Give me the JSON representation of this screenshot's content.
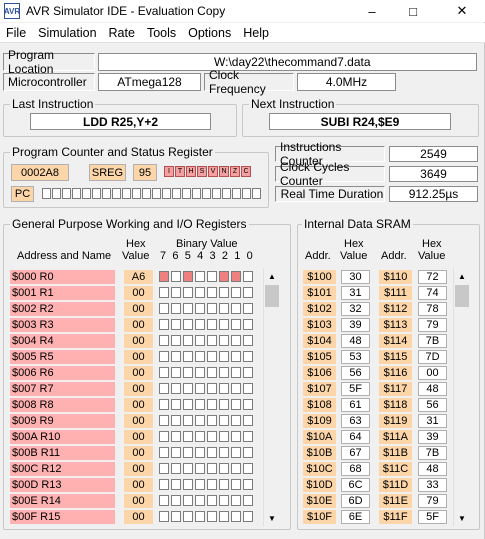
{
  "window": {
    "icon_text": "AVR",
    "title": "AVR Simulator IDE - Evaluation Copy",
    "minimize": "–",
    "maximize": "□",
    "close": "✕"
  },
  "menu": [
    "File",
    "Simulation",
    "Rate",
    "Tools",
    "Options",
    "Help"
  ],
  "top": {
    "program_location_label": "Program Location",
    "program_location": "W:\\day22\\thecommand7.data",
    "microcontroller_label": "Microcontroller",
    "microcontroller": "ATmega128",
    "clock_frequency_label": "Clock Frequency",
    "clock_frequency": "4.0MHz"
  },
  "last_instruction": {
    "title": "Last Instruction",
    "value": "LDD R25,Y+2"
  },
  "next_instruction": {
    "title": "Next Instruction",
    "value": "SUBI R24,$E9"
  },
  "pc_sreg": {
    "title": "Program Counter and Status Register",
    "pc_value": "0002A8",
    "sreg_label": "SREG",
    "sreg_value": "95",
    "flags": [
      "I",
      "T",
      "H",
      "S",
      "V",
      "N",
      "Z",
      "C"
    ],
    "pc_label": "PC"
  },
  "counters": {
    "instructions_label": "Instructions Counter",
    "instructions": "2549",
    "clock_cycles_label": "Clock Cycles Counter",
    "clock_cycles": "3649",
    "real_time_label": "Real Time Duration",
    "real_time": "912.25µs"
  },
  "registers": {
    "title": "General Purpose Working and I/O Registers",
    "col_address": "Address and Name",
    "col_hex_1": "Hex",
    "col_hex_2": "Value",
    "col_binary": "Binary Value",
    "bit_labels": "7 6 5 4 3 2 1 0",
    "rows": [
      {
        "name": "$000  R0",
        "hex": "A6",
        "bits": [
          1,
          0,
          1,
          0,
          0,
          1,
          1,
          0
        ]
      },
      {
        "name": "$001  R1",
        "hex": "00",
        "bits": [
          0,
          0,
          0,
          0,
          0,
          0,
          0,
          0
        ]
      },
      {
        "name": "$002  R2",
        "hex": "00",
        "bits": [
          0,
          0,
          0,
          0,
          0,
          0,
          0,
          0
        ]
      },
      {
        "name": "$003  R3",
        "hex": "00",
        "bits": [
          0,
          0,
          0,
          0,
          0,
          0,
          0,
          0
        ]
      },
      {
        "name": "$004  R4",
        "hex": "00",
        "bits": [
          0,
          0,
          0,
          0,
          0,
          0,
          0,
          0
        ]
      },
      {
        "name": "$005  R5",
        "hex": "00",
        "bits": [
          0,
          0,
          0,
          0,
          0,
          0,
          0,
          0
        ]
      },
      {
        "name": "$006  R6",
        "hex": "00",
        "bits": [
          0,
          0,
          0,
          0,
          0,
          0,
          0,
          0
        ]
      },
      {
        "name": "$007  R7",
        "hex": "00",
        "bits": [
          0,
          0,
          0,
          0,
          0,
          0,
          0,
          0
        ]
      },
      {
        "name": "$008  R8",
        "hex": "00",
        "bits": [
          0,
          0,
          0,
          0,
          0,
          0,
          0,
          0
        ]
      },
      {
        "name": "$009  R9",
        "hex": "00",
        "bits": [
          0,
          0,
          0,
          0,
          0,
          0,
          0,
          0
        ]
      },
      {
        "name": "$00A  R10",
        "hex": "00",
        "bits": [
          0,
          0,
          0,
          0,
          0,
          0,
          0,
          0
        ]
      },
      {
        "name": "$00B  R11",
        "hex": "00",
        "bits": [
          0,
          0,
          0,
          0,
          0,
          0,
          0,
          0
        ]
      },
      {
        "name": "$00C  R12",
        "hex": "00",
        "bits": [
          0,
          0,
          0,
          0,
          0,
          0,
          0,
          0
        ]
      },
      {
        "name": "$00D  R13",
        "hex": "00",
        "bits": [
          0,
          0,
          0,
          0,
          0,
          0,
          0,
          0
        ]
      },
      {
        "name": "$00E  R14",
        "hex": "00",
        "bits": [
          0,
          0,
          0,
          0,
          0,
          0,
          0,
          0
        ]
      },
      {
        "name": "$00F  R15",
        "hex": "00",
        "bits": [
          0,
          0,
          0,
          0,
          0,
          0,
          0,
          0
        ]
      }
    ]
  },
  "sram": {
    "title": "Internal Data SRAM",
    "col_addr": "Addr.",
    "col_hex_1": "Hex",
    "col_hex_2": "Value",
    "rows": [
      {
        "a1": "$100",
        "v1": "30",
        "a2": "$110",
        "v2": "72"
      },
      {
        "a1": "$101",
        "v1": "31",
        "a2": "$111",
        "v2": "74"
      },
      {
        "a1": "$102",
        "v1": "32",
        "a2": "$112",
        "v2": "78"
      },
      {
        "a1": "$103",
        "v1": "39",
        "a2": "$113",
        "v2": "79"
      },
      {
        "a1": "$104",
        "v1": "48",
        "a2": "$114",
        "v2": "7B"
      },
      {
        "a1": "$105",
        "v1": "53",
        "a2": "$115",
        "v2": "7D"
      },
      {
        "a1": "$106",
        "v1": "56",
        "a2": "$116",
        "v2": "00"
      },
      {
        "a1": "$107",
        "v1": "5F",
        "a2": "$117",
        "v2": "48"
      },
      {
        "a1": "$108",
        "v1": "61",
        "a2": "$118",
        "v2": "56"
      },
      {
        "a1": "$109",
        "v1": "63",
        "a2": "$119",
        "v2": "31"
      },
      {
        "a1": "$10A",
        "v1": "64",
        "a2": "$11A",
        "v2": "39"
      },
      {
        "a1": "$10B",
        "v1": "67",
        "a2": "$11B",
        "v2": "7B"
      },
      {
        "a1": "$10C",
        "v1": "68",
        "a2": "$11C",
        "v2": "48"
      },
      {
        "a1": "$10D",
        "v1": "6C",
        "a2": "$11D",
        "v2": "33"
      },
      {
        "a1": "$10E",
        "v1": "6D",
        "a2": "$11E",
        "v2": "79"
      },
      {
        "a1": "$10F",
        "v1": "6E",
        "a2": "$11F",
        "v2": "5F"
      }
    ]
  },
  "scroll": {
    "up": "▲",
    "down": "▼"
  }
}
